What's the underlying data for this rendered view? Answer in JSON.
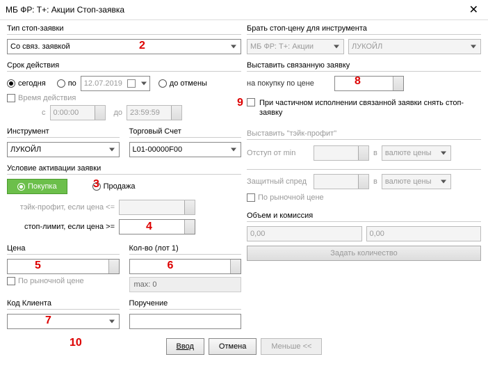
{
  "window": {
    "title": "МБ ФР: Т+: Акции Стоп-заявка"
  },
  "left": {
    "type_label": "Тип стоп-заявки",
    "type_value": "Со связ. заявкой",
    "validity_label": "Срок действия",
    "today": "сегодня",
    "until": "по",
    "date": "12.07.2019",
    "cancel": "до отмены",
    "time_action": "Время действия",
    "from": "с",
    "time_from": "0:00:00",
    "to": "до",
    "time_to": "23:59:59",
    "instrument_label": "Инструмент",
    "instrument_value": "ЛУКОЙЛ",
    "account_label": "Торговый Счет",
    "account_value": "L01-00000F00",
    "activation_label": "Условие активации заявки",
    "buy": "Покупка",
    "sell": "Продажа",
    "take_profit": "тэйк-профит, если цена <=",
    "stop_limit": "стоп-лимит, если цена >=",
    "price_label": "Цена",
    "qty_label": "Кол-во (лот 1)",
    "market_price": "По рыночной цене",
    "max": "max: 0",
    "client_label": "Код Клиента",
    "order_label": "Поручение"
  },
  "right": {
    "take_from_label": "Брать стоп-цену для инструмента",
    "market": "МБ ФР: Т+: Акции",
    "instrument": "ЛУКОЙЛ",
    "linked_label": "Выставить связанную заявку",
    "buy_at_price": "на покупку по цене",
    "partial_exec": "При частичном исполнении связанной заявки снять стоп-заявку",
    "tp_label": "Выставить \"тэйк-профит\"",
    "offset": "Отступ от min",
    "in": "в",
    "currency": "валюте цены",
    "spread": "Защитный спред",
    "market_price": "По рыночной цене",
    "volume_label": "Объем и комиссия",
    "zero": "0,00",
    "set_qty": "Задать количество"
  },
  "footer": {
    "enter": "Ввод",
    "cancel": "Отмена",
    "less": "Меньше <<"
  },
  "ann": {
    "a2": "2",
    "a3": "3",
    "a4": "4",
    "a5": "5",
    "a6": "6",
    "a7": "7",
    "a8": "8",
    "a9": "9",
    "a10": "10"
  }
}
